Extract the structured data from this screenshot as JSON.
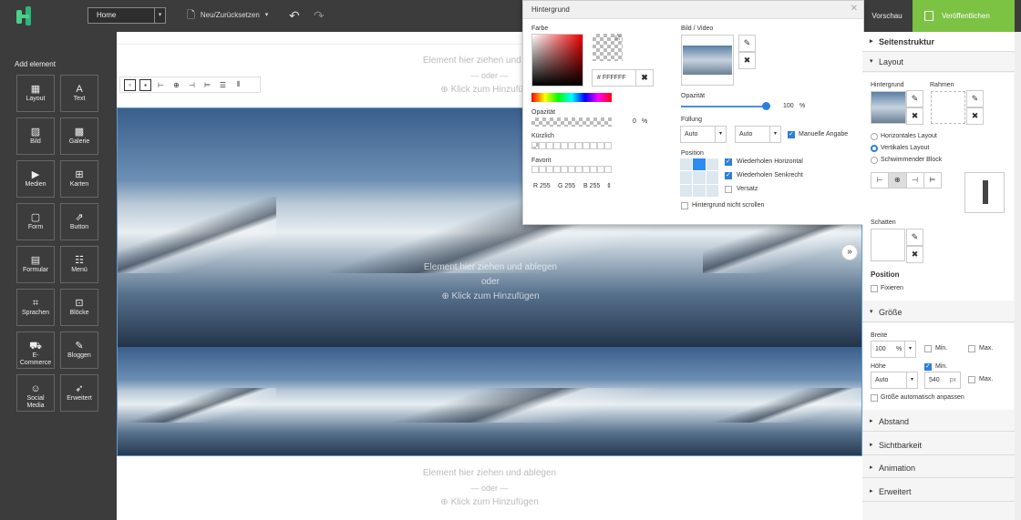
{
  "topbar": {
    "page_select": "Home",
    "newreset_label": "Neu/Zurücksetzen",
    "preview_label": "Vorschau",
    "publish_label": "Veröffentlichen"
  },
  "left": {
    "title": "Add element",
    "items": [
      {
        "label": "Layout",
        "icon": "layout-icon",
        "glyph": "▦"
      },
      {
        "label": "Text",
        "icon": "text-icon",
        "glyph": "A"
      },
      {
        "label": "Bild",
        "icon": "image-icon",
        "glyph": "▨"
      },
      {
        "label": "Galerie",
        "icon": "gallery-icon",
        "glyph": "▩"
      },
      {
        "label": "Medien",
        "icon": "media-icon",
        "glyph": "▶"
      },
      {
        "label": "Karten",
        "icon": "map-icon",
        "glyph": "⊞"
      },
      {
        "label": "Form",
        "icon": "form-icon",
        "glyph": "▢"
      },
      {
        "label": "Button",
        "icon": "button-icon",
        "glyph": "⇗"
      },
      {
        "label": "Formular",
        "icon": "formular-icon",
        "glyph": "▤"
      },
      {
        "label": "Menü",
        "icon": "menu-icon",
        "glyph": "☷"
      },
      {
        "label": "Sprachen",
        "icon": "language-icon",
        "glyph": "⌗"
      },
      {
        "label": "Blöcke",
        "icon": "blocks-icon",
        "glyph": "⊡"
      },
      {
        "label": "E-Commerce",
        "icon": "cart-icon",
        "glyph": "⛟"
      },
      {
        "label": "Bloggen",
        "icon": "blog-icon",
        "glyph": "✎"
      },
      {
        "label": "Social Media",
        "icon": "social-icon",
        "glyph": "☺"
      },
      {
        "label": "Erweitert",
        "icon": "rocket-icon",
        "glyph": "➶"
      }
    ]
  },
  "canvas": {
    "drop_text": "Element hier ziehen und ablegen",
    "or_text": "— oder —",
    "add_text": "Klick zum Hinzufügen",
    "center_drop_text": "Element hier ziehen und ablegen",
    "center_or_text": "oder",
    "center_add_text": "Klick zum Hinzufügen"
  },
  "popup": {
    "title": "Hintergrund",
    "farbe_label": "Farbe",
    "hex_prefix": "#",
    "hex_value": "FFFFFF",
    "opacity_label": "Opazität",
    "opacity_value": "0",
    "percent": "%",
    "recent_label": "Kürzlich",
    "favorite_label": "Favorit",
    "r_label": "R 255",
    "g_label": "G 255",
    "b_label": "B 255",
    "image_label": "Bild / Video",
    "image_opacity_label": "Opazität",
    "image_opacity_value": "100",
    "fill_label": "Füllung",
    "fill_x": "Auto",
    "fill_y": "Auto",
    "manual_label": "Manuelle Angabe",
    "position_label": "Position",
    "repeat_h_label": "Wiederholen Horizontal",
    "repeat_v_label": "Wiederholen Senkrecht",
    "offset_label": "Versatz",
    "noscroll_label": "Hintergrund nicht scrollen"
  },
  "right": {
    "structure_label": "Seitenstruktur",
    "layout_label": "Layout",
    "background_label": "Hintergrund",
    "border_label": "Rahmen",
    "horiz_label": "Horizontales Layout",
    "vert_label": "Vertikales Layout",
    "float_label": "Schwimmender Block",
    "shadow_label": "Schatten",
    "position_label": "Position",
    "fix_label": "Fixieren",
    "size_label": "Größe",
    "width_label": "Breite",
    "width_value": "100",
    "width_unit": "%",
    "min_label": "Min.",
    "max_label": "Max.",
    "height_label": "Höhe",
    "height_mode": "Auto",
    "height_value": "540",
    "height_unit": "px",
    "autosize_label": "Größe automatisch anpassen",
    "spacing_label": "Abstand",
    "visibility_label": "Sichtbarkeit",
    "animation_label": "Animation",
    "advanced_label": "Erweitert"
  }
}
